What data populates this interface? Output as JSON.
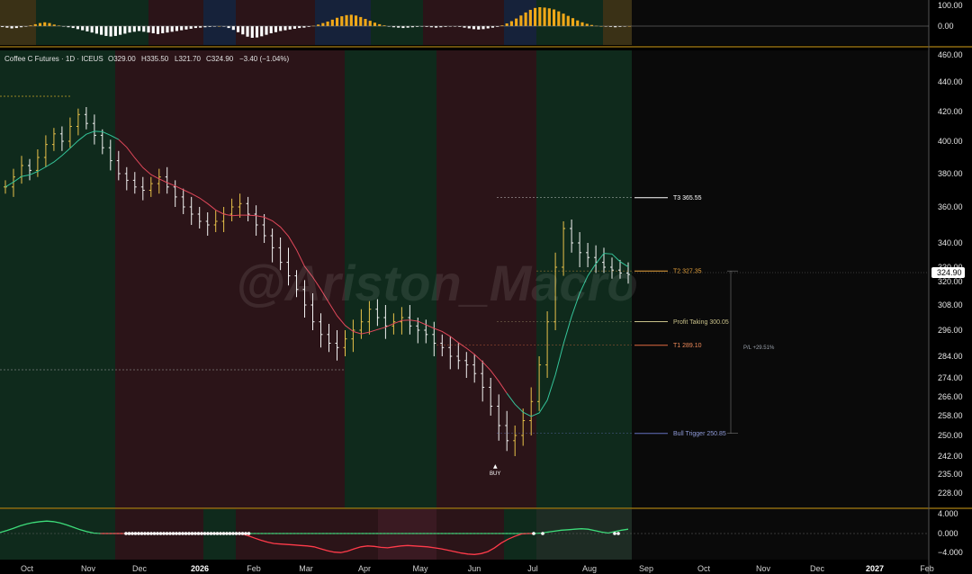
{
  "header": {
    "symbol": "Coffee C Futures · 1D · ICEUS",
    "open": "O329.00",
    "high": "H335.50",
    "low": "L321.70",
    "close": "C324.90",
    "change": "−3.40 (−1.04%)"
  },
  "watermark": "@Ariston_Macro",
  "price_tag": "324.90",
  "signal_label": "BUY",
  "pl_label": "P/L +29.51%",
  "chart_data": [
    {
      "type": "bar",
      "panel": "oscillator-top",
      "y_ticks": [
        "100.00",
        "0.00"
      ],
      "ylim": [
        -60,
        100
      ],
      "values": [
        -5,
        -8,
        -12,
        -10,
        -6,
        -3,
        4,
        10,
        16,
        20,
        16,
        8,
        3,
        -2,
        -6,
        -10,
        -16,
        -22,
        -28,
        -34,
        -40,
        -46,
        -52,
        -55,
        -52,
        -46,
        -40,
        -34,
        -30,
        -26,
        -30,
        -34,
        -38,
        -42,
        -38,
        -34,
        -30,
        -26,
        -22,
        -18,
        -14,
        -10,
        -8,
        -6,
        -4,
        -2,
        0,
        -2,
        -10,
        -20,
        -32,
        -44,
        -56,
        -62,
        -60,
        -54,
        -46,
        -38,
        -32,
        -26,
        -22,
        -18,
        -14,
        -10,
        -8,
        -4,
        2,
        8,
        16,
        24,
        34,
        44,
        52,
        58,
        60,
        56,
        48,
        38,
        28,
        18,
        10,
        4,
        -2,
        -6,
        -8,
        -10,
        -8,
        -6,
        -4,
        -2,
        -4,
        -6,
        -8,
        -6,
        -4,
        -2,
        -2,
        -4,
        -8,
        -12,
        -16,
        -18,
        -16,
        -12,
        -8,
        -4,
        4,
        14,
        26,
        40,
        56,
        72,
        86,
        96,
        100,
        98,
        94,
        88,
        78,
        66,
        54,
        42,
        30,
        20,
        12,
        6,
        2,
        0,
        -2,
        -4,
        -6,
        -4,
        -2,
        0
      ]
    },
    {
      "type": "line",
      "panel": "main",
      "y_ticks": [
        "460.00",
        "440.00",
        "420.00",
        "400.00",
        "380.00",
        "360.00",
        "340.00",
        "330.00",
        "320.00",
        "308.00",
        "296.00",
        "284.00",
        "274.00",
        "266.00",
        "258.00",
        "250.00",
        "242.00",
        "235.00",
        "228.00"
      ],
      "x_ticks": [
        "Oct",
        "Nov",
        "Dec",
        "2026",
        "Feb",
        "Mar",
        "Apr",
        "May",
        "Jun",
        "Jul",
        "Aug",
        "Sep",
        "Oct",
        "Nov",
        "Dec",
        "2027",
        "Feb"
      ],
      "series": [
        {
          "values": [
            372,
            378,
            385,
            382,
            390,
            398,
            405,
            400,
            410,
            418,
            412,
            404,
            396,
            388,
            380,
            376,
            372,
            370,
            374,
            378,
            372,
            366,
            360,
            356,
            352,
            350,
            352,
            356,
            360,
            362,
            356,
            350,
            344,
            338,
            332,
            324,
            316,
            308,
            300,
            294,
            290,
            288,
            292,
            296,
            300,
            306,
            302,
            298,
            300,
            302,
            298,
            296,
            294,
            290,
            288,
            284,
            282,
            280,
            276,
            270,
            262,
            254,
            248,
            250,
            256,
            264,
            280,
            300,
            330,
            348,
            340,
            336,
            334,
            332,
            330,
            328,
            326,
            325
          ]
        },
        {
          "name": "T3 365.55",
          "values": [
            365.55
          ]
        },
        {
          "name": "T2 327.35",
          "values": [
            327.35
          ]
        },
        {
          "name": "Profit Taking 300.05",
          "values": [
            300.05
          ]
        },
        {
          "name": "T1 289.10",
          "values": [
            289.1
          ]
        },
        {
          "name": "Bull Trigger 250.85",
          "values": [
            250.85
          ]
        }
      ]
    },
    {
      "type": "line",
      "panel": "oscillator-bottom",
      "y_ticks": [
        "4.000",
        "0.000",
        "−4.000"
      ],
      "ylim": [
        -5,
        5
      ],
      "values": [
        0.2,
        0.6,
        1.1,
        1.6,
        2.0,
        2.3,
        2.5,
        2.6,
        2.5,
        2.2,
        1.8,
        1.3,
        0.8,
        0.4,
        0.1,
        0,
        0,
        0,
        0,
        0,
        0,
        0,
        0,
        0,
        0,
        0,
        0,
        0,
        0,
        0,
        0,
        0,
        0,
        0,
        0,
        0,
        0,
        -0.4,
        -0.9,
        -1.4,
        -1.8,
        -2.1,
        -2.2,
        -2.3,
        -2.4,
        -2.5,
        -2.6,
        -2.8,
        -3.2,
        -3.6,
        -3.9,
        -4.0,
        -3.7,
        -3.2,
        -2.8,
        -2.6,
        -2.7,
        -2.9,
        -3.0,
        -2.8,
        -2.6,
        -2.5,
        -2.6,
        -2.7,
        -2.8,
        -3.0,
        -3.2,
        -3.5,
        -3.8,
        -4.1,
        -4.3,
        -4.4,
        -4.2,
        -3.8,
        -3.0,
        -2.0,
        -1.2,
        -0.6,
        -0.1,
        0,
        0,
        0.1,
        0.3,
        0.5,
        0.7,
        0.8,
        0.9,
        1.0,
        0.9,
        0.6,
        0.3,
        0.1,
        0.4,
        0.7,
        0.9
      ]
    }
  ]
}
